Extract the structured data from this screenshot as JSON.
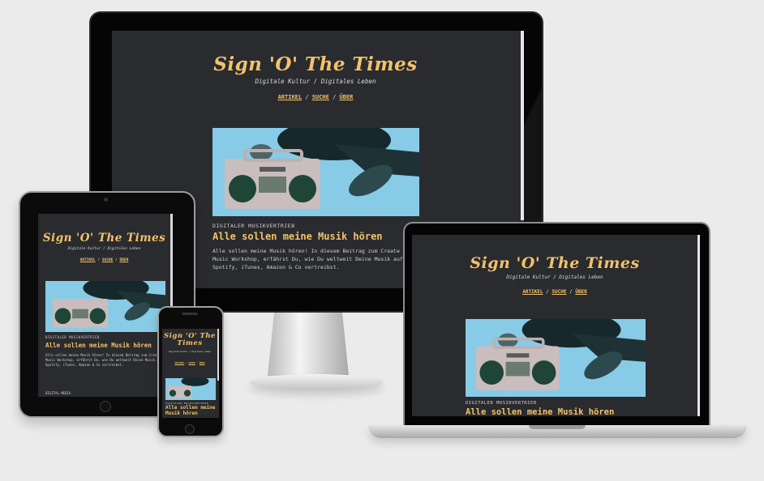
{
  "site": {
    "title": "Sign 'O' The Times",
    "tagline": "Digitale Kultur / Digitales Leben",
    "nav": {
      "artikel": "ARTIKEL",
      "suche": "SUCHE",
      "ueber": "ÜBER",
      "separator": "/"
    }
  },
  "article": {
    "category": "DIGITALER MUSIKVERTRIEB",
    "title": "Alle sollen meine Musik hören",
    "excerpt_desktop": "Alle sollen meine Musik hören! In diesem Beitrag zum Create Music Workshop, erfährst Du, wie Du weltweit Deine Musik auf Spotify, iTunes, Amazon & Co vertreibst.",
    "excerpt_tablet": "Alle sollen meine Musik hören! In diesem Beitrag zum Create Music Workshop, erfährst Du, wie Du weltweit Deine Musik auf Spotify, iTunes, Amazon & Co vertreibst."
  },
  "footer": {
    "text": "DIGITAL MEDIA"
  },
  "colors": {
    "accent": "#f3c26a",
    "screen_bg": "#2a2b2e",
    "page_bg": "#ebebeb"
  }
}
